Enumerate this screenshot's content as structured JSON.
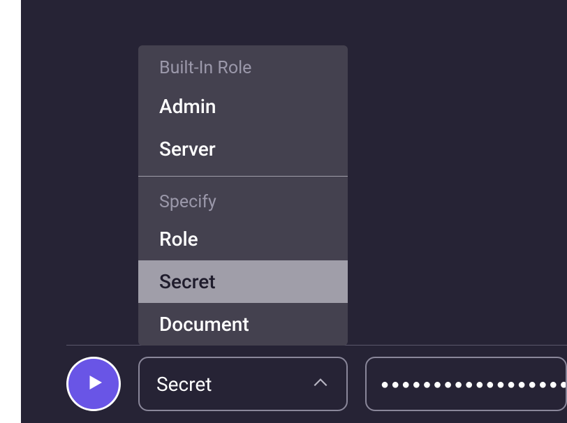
{
  "dropdown": {
    "sections": [
      {
        "header": "Built-In Role",
        "items": [
          "Admin",
          "Server"
        ]
      },
      {
        "header": "Specify",
        "items": [
          "Role",
          "Secret",
          "Document"
        ]
      }
    ],
    "selected": "Secret"
  },
  "password": {
    "masked_value": "●●●●●●●●●●●●●●●●●●●●●●●●●●●●●●●●●●●●●●●●"
  },
  "colors": {
    "background": "#262335",
    "accent": "#6955e6",
    "menu_bg": "#44414f",
    "highlight": "#a09ea9"
  }
}
